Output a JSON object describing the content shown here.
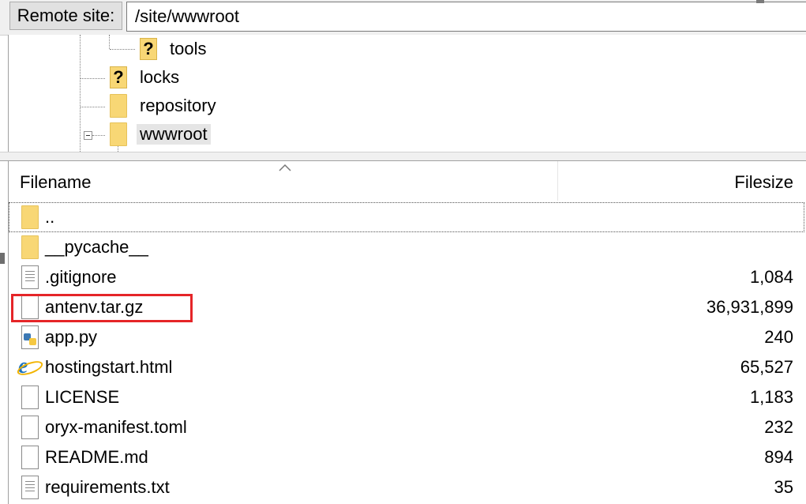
{
  "remote_bar": {
    "label": "Remote site:",
    "path": "/site/wwwroot"
  },
  "tree": {
    "nodes": [
      {
        "label": "tools",
        "icon": "question-folder-icon"
      },
      {
        "label": "locks",
        "icon": "question-folder-icon"
      },
      {
        "label": "repository",
        "icon": "folder-icon"
      },
      {
        "label": "wwwroot",
        "icon": "folder-icon",
        "selected": true
      }
    ]
  },
  "file_list": {
    "columns": {
      "filename": "Filename",
      "filesize": "Filesize"
    },
    "rows": [
      {
        "name": "..",
        "size": "",
        "icon": "folder-icon"
      },
      {
        "name": "__pycache__",
        "size": "",
        "icon": "folder-icon"
      },
      {
        "name": ".gitignore",
        "size": "1,084",
        "icon": "text-file-icon"
      },
      {
        "name": "antenv.tar.gz",
        "size": "36,931,899",
        "icon": "file-icon"
      },
      {
        "name": "app.py",
        "size": "240",
        "icon": "python-file-icon"
      },
      {
        "name": "hostingstart.html",
        "size": "65,527",
        "icon": "ie-html-icon"
      },
      {
        "name": "LICENSE",
        "size": "1,183",
        "icon": "file-icon"
      },
      {
        "name": "oryx-manifest.toml",
        "size": "232",
        "icon": "file-icon"
      },
      {
        "name": "README.md",
        "size": "894",
        "icon": "file-icon"
      },
      {
        "name": "requirements.txt",
        "size": "35",
        "icon": "text-file-icon"
      }
    ]
  },
  "colors": {
    "highlight": "#e52528",
    "folder": "#f8d775"
  }
}
